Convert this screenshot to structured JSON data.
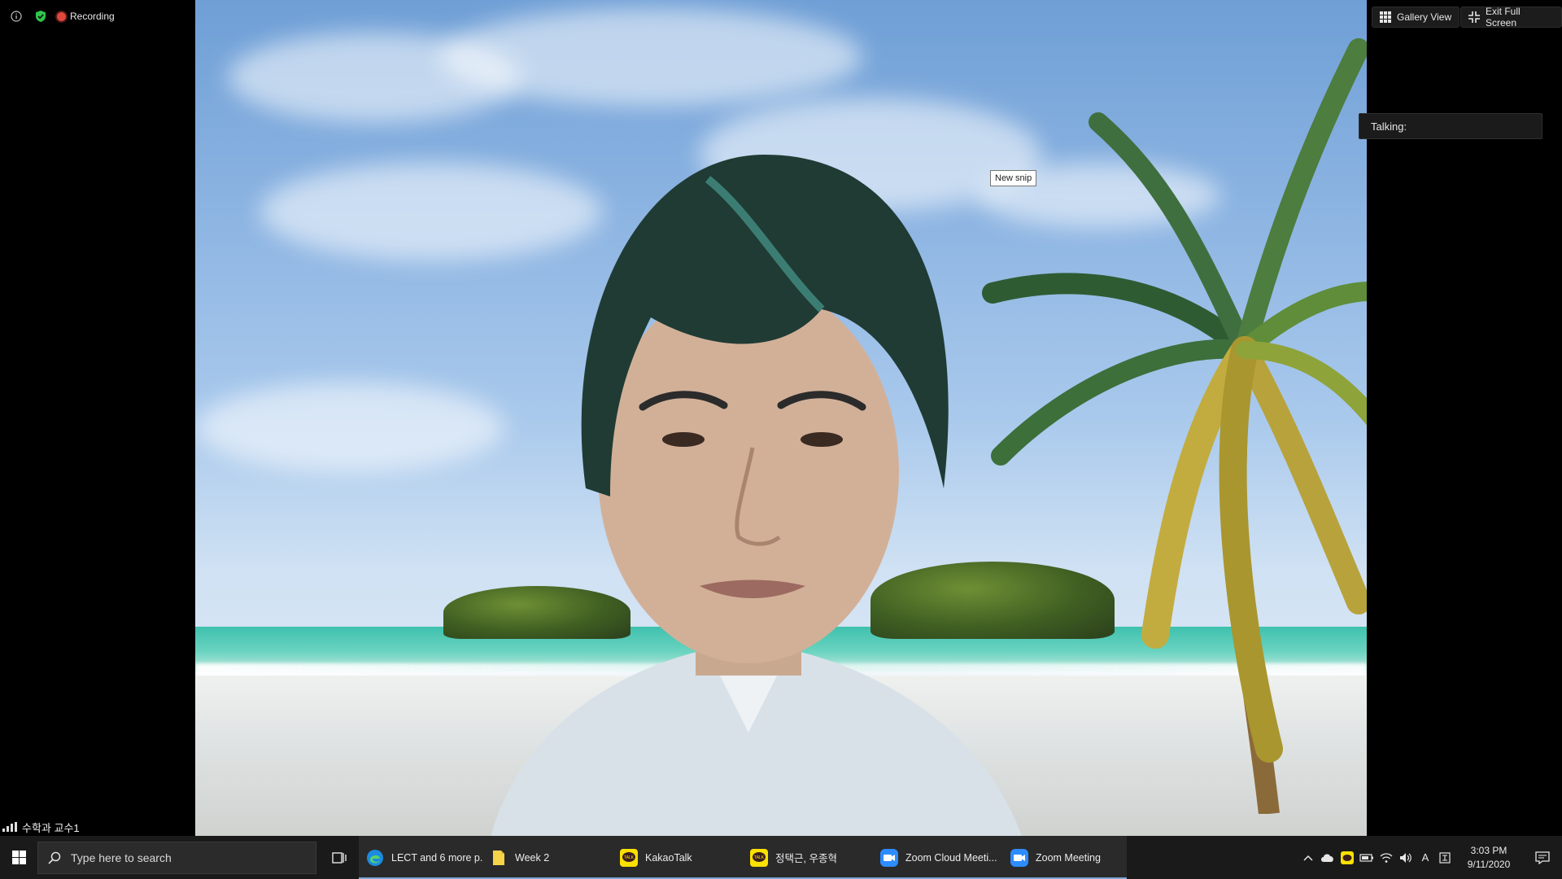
{
  "meeting": {
    "recording_label": "Recording",
    "gallery_view_label": "Gallery View",
    "exit_full_screen_label": "Exit Full Screen",
    "talking_label": "Talking:",
    "participant_name": "수학과 교수1"
  },
  "snip_tooltip": "New snip",
  "taskbar": {
    "search_placeholder": "Type here to search",
    "apps": [
      {
        "label": "LECT and 6 more p...",
        "icon": "edge-icon"
      },
      {
        "label": "Week 2",
        "icon": "folder-icon"
      },
      {
        "label": "KakaoTalk",
        "icon": "kakaotalk-icon"
      },
      {
        "label": "정택근, 우종혁",
        "icon": "kakaotalk-icon"
      },
      {
        "label": "Zoom Cloud Meeti...",
        "icon": "zoom-icon"
      },
      {
        "label": "Zoom Meeting",
        "icon": "zoom-icon"
      }
    ],
    "tray_language": "A",
    "clock_time": "3:03 PM",
    "clock_date": "9/11/2020"
  },
  "colors": {
    "recording_red": "#e0483e",
    "shield_green": "#2ec74b",
    "zoom_blue": "#2d8cff",
    "kakao_yellow": "#fae100",
    "taskbar_bg": "#1a1a1a"
  }
}
